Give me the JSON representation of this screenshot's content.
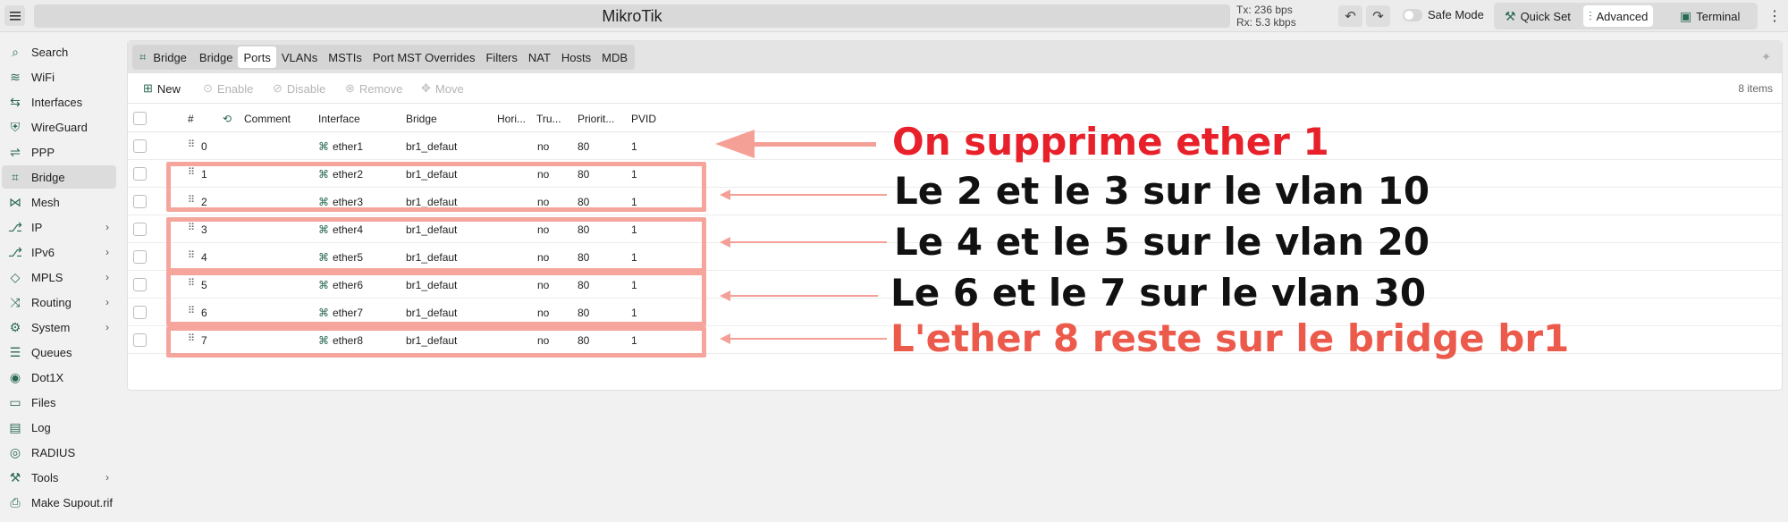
{
  "app": {
    "title": "MikroTik",
    "tx": "Tx: 236 bps",
    "rx": "Rx: 5.3 kbps",
    "safe_mode_label": "Safe Mode",
    "modes": [
      "Quick Set",
      "Advanced",
      "Terminal"
    ],
    "active_mode": "Advanced"
  },
  "sidebar": {
    "items": [
      {
        "label": "Search",
        "icon": "search-icon"
      },
      {
        "label": "WiFi",
        "icon": "wifi-icon"
      },
      {
        "label": "Interfaces",
        "icon": "interfaces-icon"
      },
      {
        "label": "WireGuard",
        "icon": "shield-icon"
      },
      {
        "label": "PPP",
        "icon": "ppp-icon"
      },
      {
        "label": "Bridge",
        "icon": "bridge-icon"
      },
      {
        "label": "Mesh",
        "icon": "mesh-icon"
      },
      {
        "label": "IP",
        "icon": "ip-icon"
      },
      {
        "label": "IPv6",
        "icon": "ipv6-icon"
      },
      {
        "label": "MPLS",
        "icon": "mpls-icon"
      },
      {
        "label": "Routing",
        "icon": "routing-icon"
      },
      {
        "label": "System",
        "icon": "gear-icon"
      },
      {
        "label": "Queues",
        "icon": "queues-icon"
      },
      {
        "label": "Dot1X",
        "icon": "dot1x-icon"
      },
      {
        "label": "Files",
        "icon": "folder-icon"
      },
      {
        "label": "Log",
        "icon": "log-icon"
      },
      {
        "label": "RADIUS",
        "icon": "radius-icon"
      },
      {
        "label": "Tools",
        "icon": "tools-icon"
      },
      {
        "label": "Make Supout.rif",
        "icon": "supout-icon"
      }
    ],
    "active": "Bridge"
  },
  "tabs": {
    "section": "Bridge",
    "items": [
      "Bridge",
      "Ports",
      "VLANs",
      "MSTIs",
      "Port MST Overrides",
      "Filters",
      "NAT",
      "Hosts",
      "MDB"
    ],
    "active": "Ports"
  },
  "toolbar": {
    "new": "New",
    "enable": "Enable",
    "disable": "Disable",
    "remove": "Remove",
    "move": "Move",
    "count": "8 items"
  },
  "table": {
    "headers": {
      "num": "#",
      "comment": "Comment",
      "interface": "Interface",
      "bridge": "Bridge",
      "horizon": "Hori...",
      "trusted": "Tru...",
      "priority": "Priorit...",
      "pvid": "PVID"
    },
    "rows": [
      {
        "num": "0",
        "interface": "ether1",
        "bridge": "br1_defaut",
        "trusted": "no",
        "priority": "80",
        "pvid": "1"
      },
      {
        "num": "1",
        "interface": "ether2",
        "bridge": "br1_defaut",
        "trusted": "no",
        "priority": "80",
        "pvid": "1"
      },
      {
        "num": "2",
        "interface": "ether3",
        "bridge": "br1_defaut",
        "trusted": "no",
        "priority": "80",
        "pvid": "1"
      },
      {
        "num": "3",
        "interface": "ether4",
        "bridge": "br1_defaut",
        "trusted": "no",
        "priority": "80",
        "pvid": "1"
      },
      {
        "num": "4",
        "interface": "ether5",
        "bridge": "br1_defaut",
        "trusted": "no",
        "priority": "80",
        "pvid": "1"
      },
      {
        "num": "5",
        "interface": "ether6",
        "bridge": "br1_defaut",
        "trusted": "no",
        "priority": "80",
        "pvid": "1"
      },
      {
        "num": "6",
        "interface": "ether7",
        "bridge": "br1_defaut",
        "trusted": "no",
        "priority": "80",
        "pvid": "1"
      },
      {
        "num": "7",
        "interface": "ether8",
        "bridge": "br1_defaut",
        "trusted": "no",
        "priority": "80",
        "pvid": "1"
      }
    ]
  },
  "annotations": [
    {
      "text": "On supprime ether 1",
      "color": "#e8202a"
    },
    {
      "text": "Le 2 et le 3 sur le vlan 10",
      "color": "#111111"
    },
    {
      "text": "Le 4 et le 5 sur le vlan 20",
      "color": "#111111"
    },
    {
      "text": "Le 6 et le 7 sur le vlan 30",
      "color": "#111111"
    },
    {
      "text": "L'ether 8 reste sur le bridge  br1",
      "color": "#ec5a4c"
    }
  ]
}
